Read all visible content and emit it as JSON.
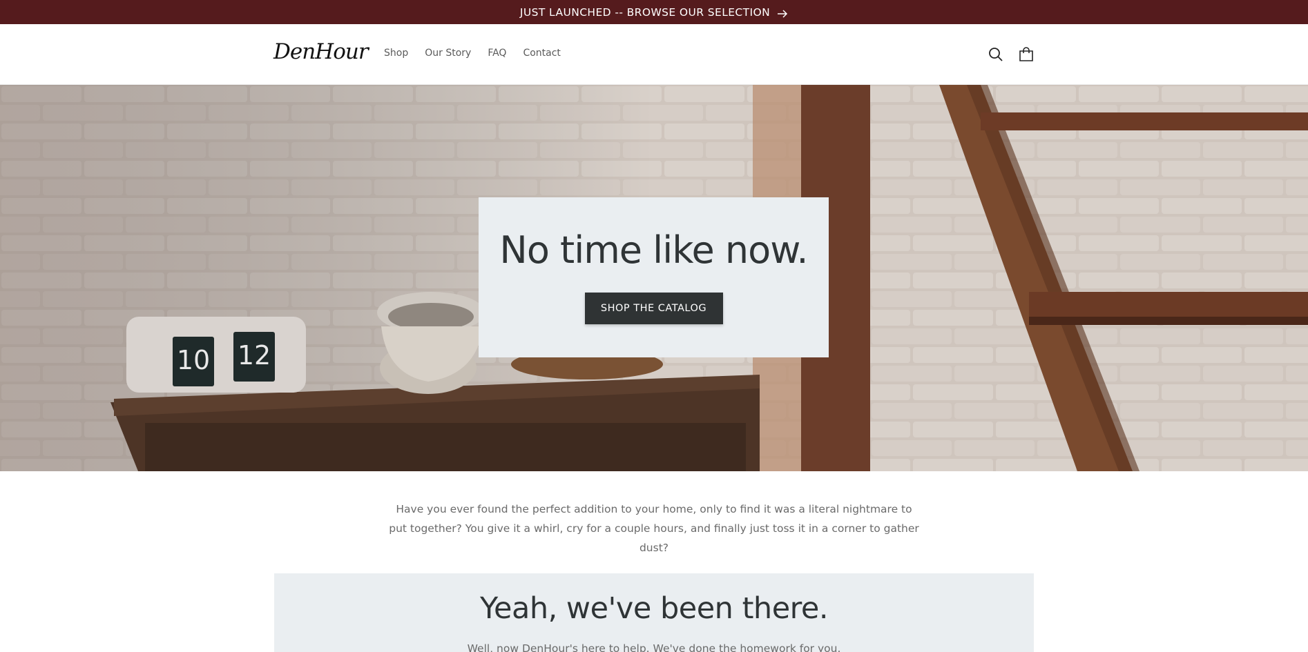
{
  "announcement": {
    "text": "JUST LAUNCHED -- BROWSE OUR SELECTION",
    "icon": "arrow-right-icon"
  },
  "header": {
    "logo": "DenHour",
    "nav": [
      "Shop",
      "Our Story",
      "FAQ",
      "Contact"
    ],
    "icons": [
      "search-icon",
      "cart-icon"
    ]
  },
  "hero": {
    "title": "No time like now.",
    "button": "SHOP THE CATALOG",
    "clock_digits": [
      "10",
      "12"
    ]
  },
  "intro": {
    "text": "Have you ever found the perfect addition to your home, only to find it was a literal nightmare to put together? You give it a whirl, cry for a couple hours, and finally just toss it in a corner to gather dust?"
  },
  "story": {
    "title": "Yeah, we've been there.",
    "text": "Well, now DenHour's here to help. We've done the homework for you."
  },
  "colors": {
    "announcement_bg": "#551b1d",
    "button_bg": "#2f3334",
    "panel_bg": "#eaeef1"
  }
}
